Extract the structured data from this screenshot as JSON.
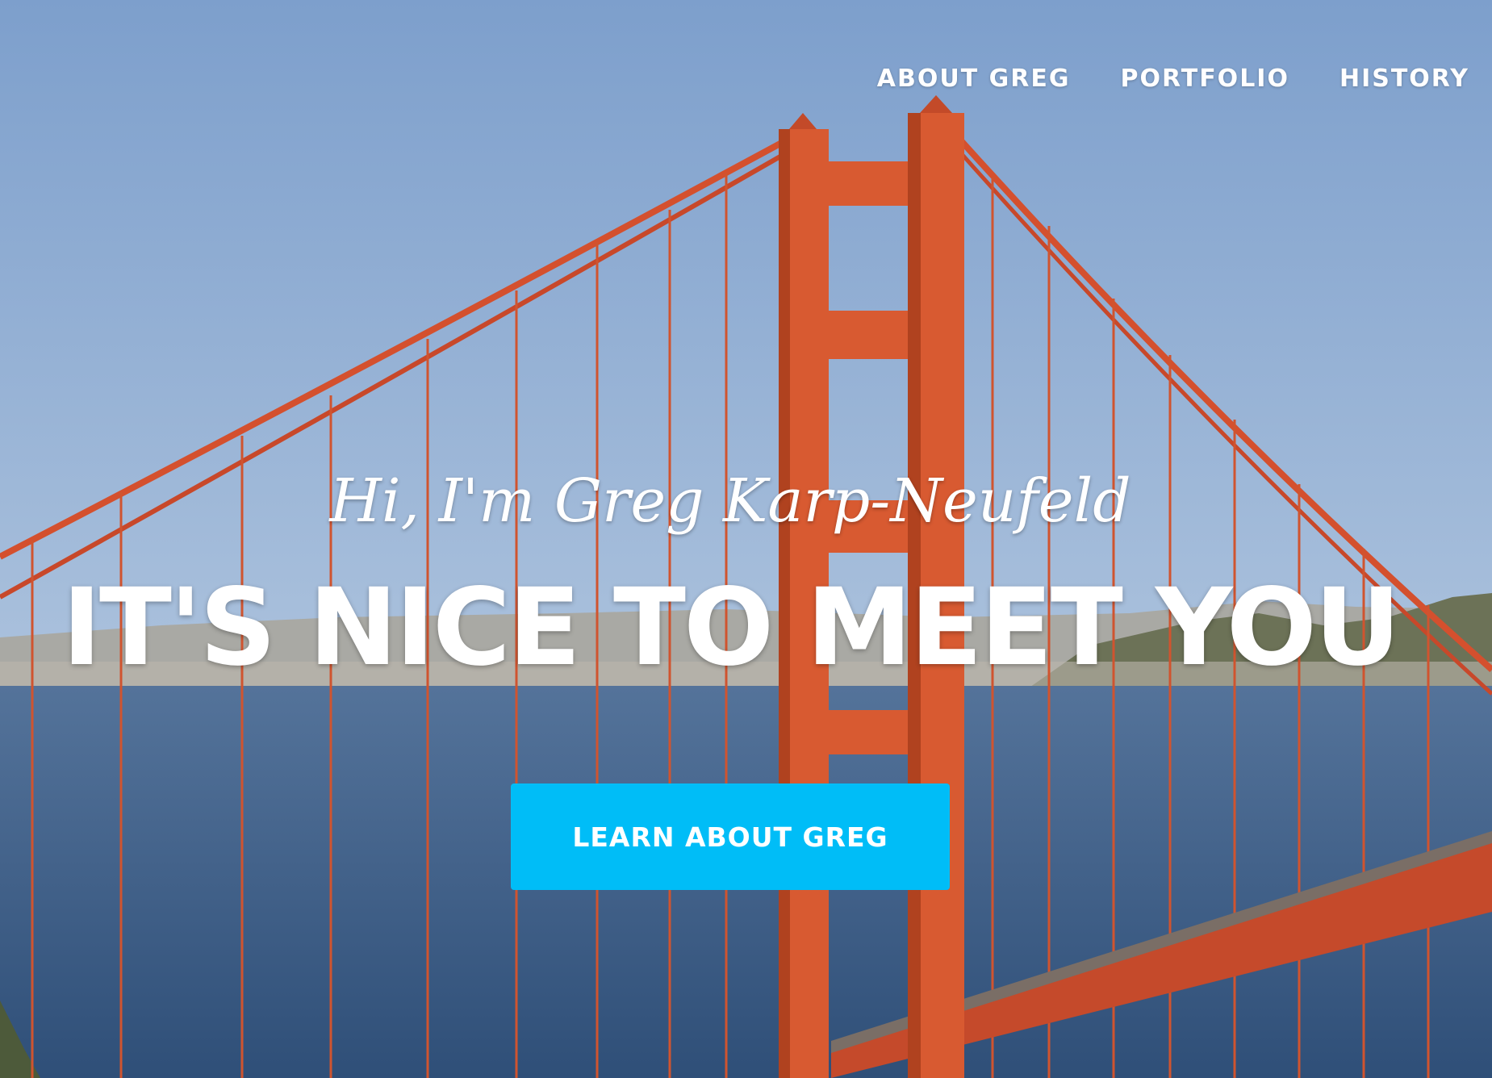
{
  "nav": {
    "items": [
      {
        "label": "ABOUT GREG"
      },
      {
        "label": "PORTFOLIO"
      },
      {
        "label": "HISTORY"
      }
    ]
  },
  "hero": {
    "subtitle": "Hi, I'm Greg Karp-Neufeld",
    "headline": "IT'S NICE TO MEET YOU",
    "cta_label": "LEARN ABOUT GREG"
  },
  "colors": {
    "cta": "#00bdf7",
    "bridge": "#d8502f",
    "sky": "#8fb1d7",
    "water": "#3e5f86"
  }
}
